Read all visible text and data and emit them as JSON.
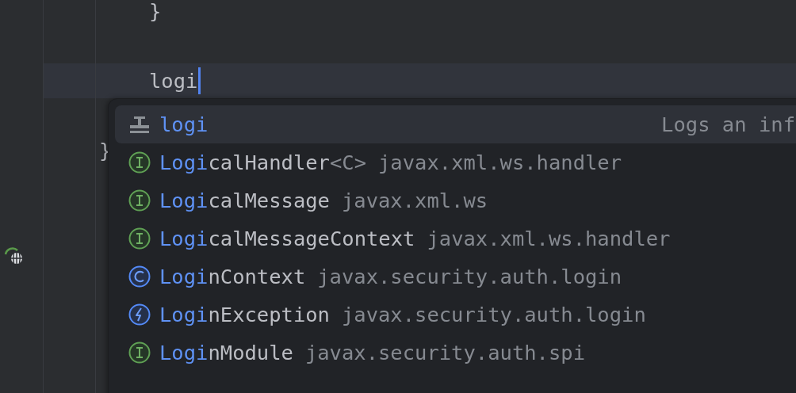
{
  "editor": {
    "lines": [
      {
        "text": "}",
        "indented": true,
        "current": false
      },
      {
        "text": "logi",
        "indented": true,
        "current": true
      },
      {
        "text": "}",
        "indented": false,
        "current": false
      }
    ]
  },
  "completion": {
    "items": [
      {
        "kind": "template",
        "selected": true,
        "match": "logi",
        "description": "Logs an inf"
      },
      {
        "kind": "interface",
        "selected": false,
        "match": "Logi",
        "rest": "calHandler",
        "type_params": "<C>",
        "package": "javax.xml.ws.handler"
      },
      {
        "kind": "interface",
        "selected": false,
        "match": "Logi",
        "rest": "calMessage",
        "package": "javax.xml.ws"
      },
      {
        "kind": "interface",
        "selected": false,
        "match": "Logi",
        "rest": "calMessageContext",
        "package": "javax.xml.ws.handler"
      },
      {
        "kind": "class",
        "selected": false,
        "match": "Logi",
        "rest": "nContext",
        "package": "javax.security.auth.login"
      },
      {
        "kind": "exception",
        "selected": false,
        "match": "Logi",
        "rest": "nException",
        "package": "javax.security.auth.login"
      },
      {
        "kind": "interface",
        "selected": false,
        "match": "Logi",
        "rest": "nModule",
        "package": "javax.security.auth.spi"
      }
    ]
  }
}
